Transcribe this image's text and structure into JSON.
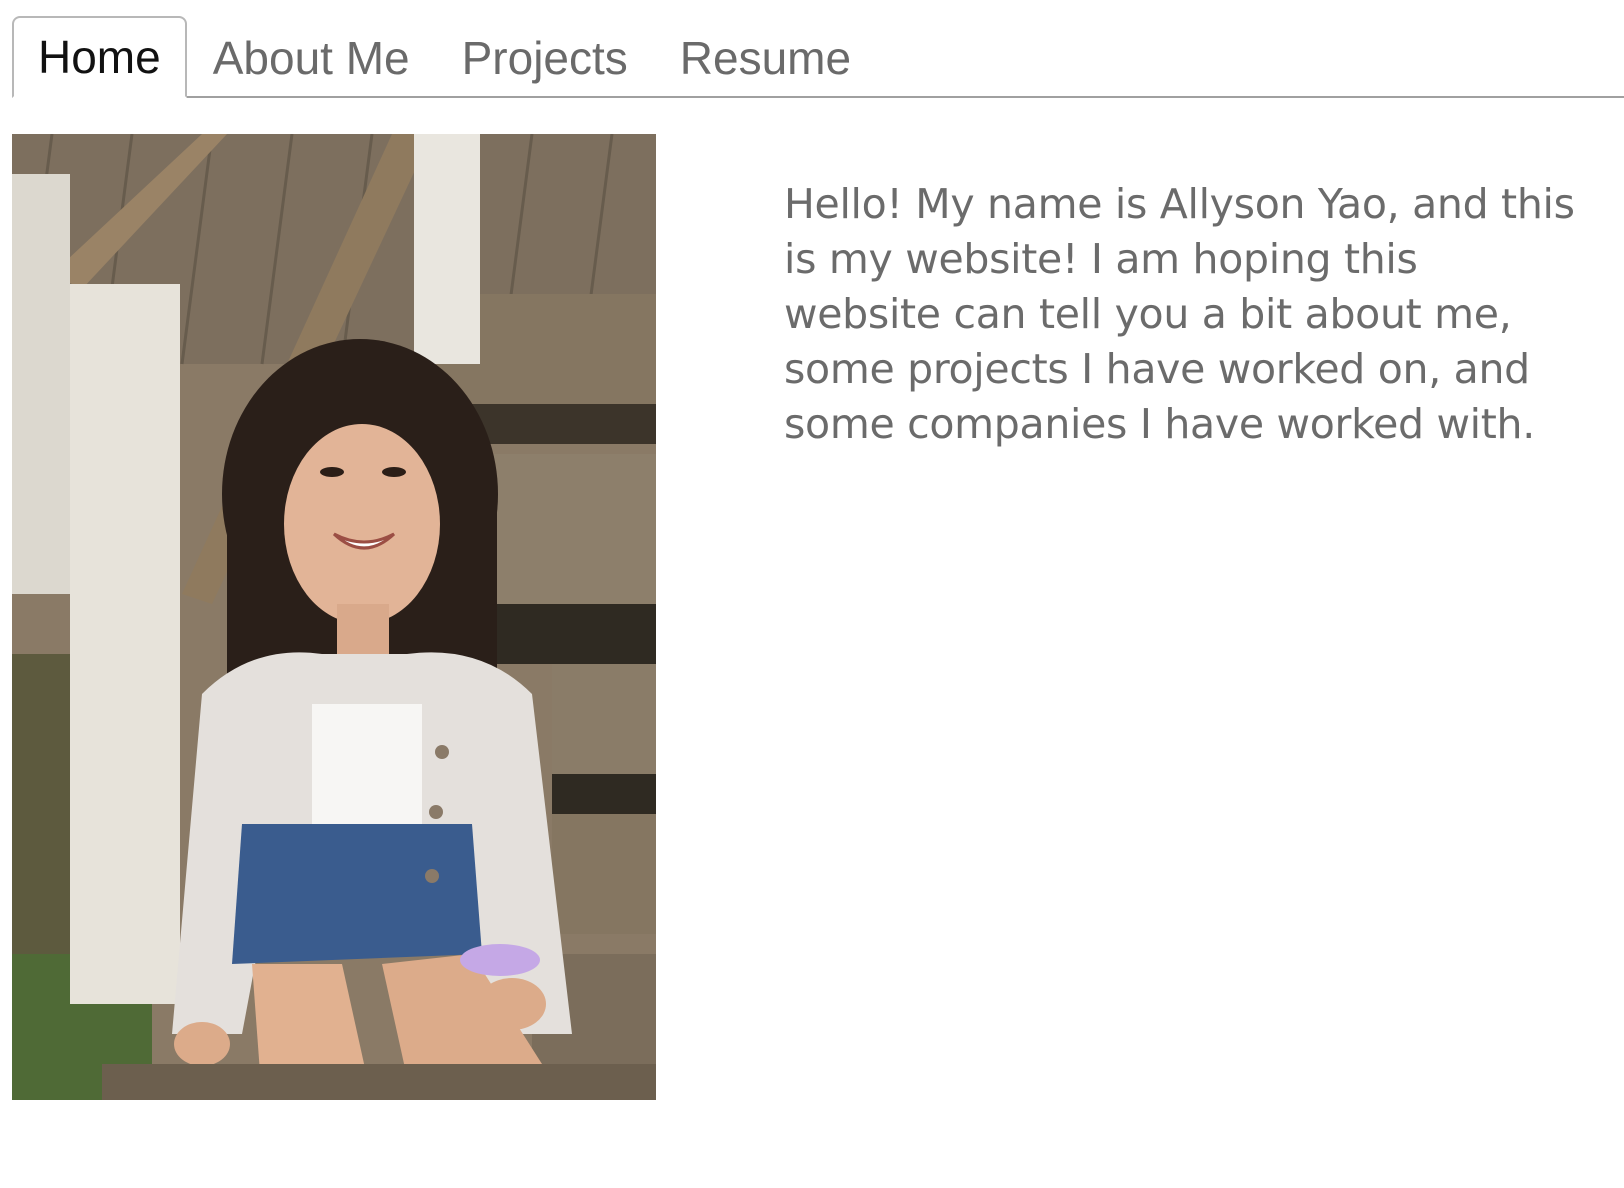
{
  "nav": {
    "tabs": [
      {
        "label": "Home",
        "active": true
      },
      {
        "label": "About Me",
        "active": false
      },
      {
        "label": "Projects",
        "active": false
      },
      {
        "label": "Resume",
        "active": false
      }
    ]
  },
  "main": {
    "photo": {
      "icon": "portrait-photo"
    },
    "intro_text": "Hello! My name is Allyson Yao, and this is my website! I am hoping this website can tell you a bit about me, some projects I have worked on, and some companies I have worked with."
  },
  "colors": {
    "active_tab_text": "#111111",
    "tab_text": "#6a6a6a",
    "body_text": "#6b6b6b",
    "tab_border": "#a0a0a0"
  }
}
